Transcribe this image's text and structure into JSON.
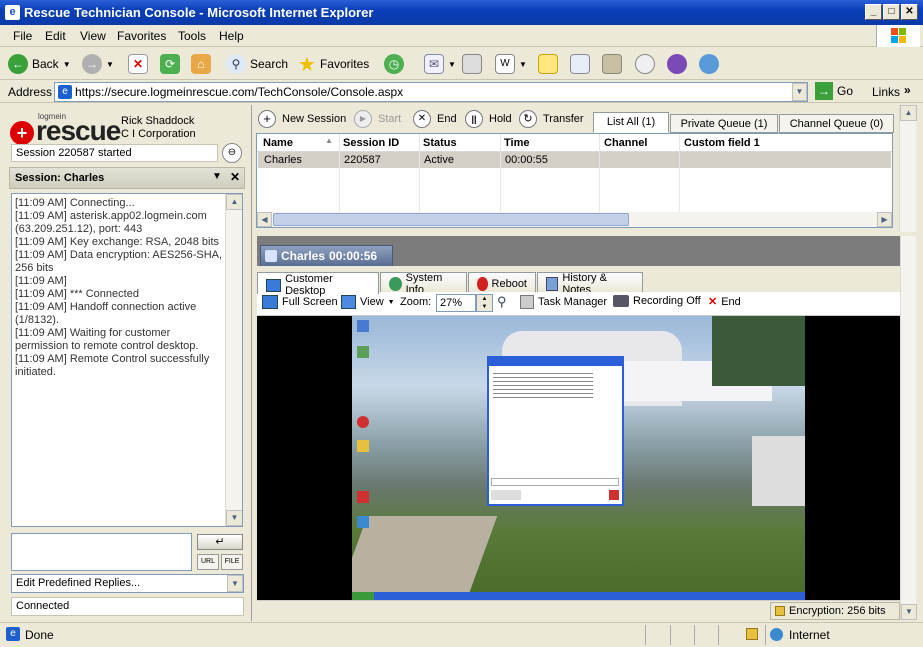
{
  "window": {
    "title": "Rescue Technician Console - Microsoft Internet Explorer"
  },
  "menu": [
    "File",
    "Edit",
    "View",
    "Favorites",
    "Tools",
    "Help"
  ],
  "toolbar": {
    "back": "Back",
    "search": "Search",
    "favorites": "Favorites"
  },
  "address": {
    "label": "Address",
    "url": "https://secure.logmeinrescue.com/TechConsole/Console.aspx",
    "go": "Go",
    "links": "Links"
  },
  "brand": {
    "logo_small": "logmein",
    "logo": "rescue",
    "user": "Rick Shaddock",
    "company": "C I Corporation"
  },
  "session": {
    "started": "Session 220587 started",
    "header": "Session: Charles"
  },
  "log": [
    "[11:09 AM] Connecting...",
    "[11:09 AM] asterisk.app02.logmein.com (63.209.251.12), port: 443",
    "[11:09 AM] Key exchange: RSA, 2048 bits",
    "[11:09 AM] Data encryption: AES256-SHA, 256 bits",
    "[11:09 AM]",
    "[11:09 AM] *** Connected",
    "[11:09 AM] Handoff connection active (1/8132).",
    "[11:09 AM] Waiting for customer permission to remote control desktop.",
    "[11:09 AM] Remote Control successfully initiated."
  ],
  "chat": {
    "url_btn": "URL",
    "file_btn": "FILE",
    "predefined": "Edit Predefined Replies...",
    "status": "Connected"
  },
  "session_toolbar": {
    "new": "New Session",
    "start": "Start",
    "end": "End",
    "hold": "Hold",
    "transfer": "Transfer"
  },
  "queue_tabs": [
    "List All (1)",
    "Private Queue (1)",
    "Channel Queue (0)"
  ],
  "table": {
    "headers": [
      "Name",
      "Session ID",
      "Status",
      "Time",
      "Channel",
      "Custom field 1"
    ],
    "rows": [
      [
        "Charles",
        "220587",
        "Active",
        "00:00:55",
        "",
        ""
      ]
    ]
  },
  "active_session": {
    "label": "Charles",
    "timer": "00:00:56"
  },
  "session_tabs": [
    "Customer Desktop",
    "System Info",
    "Reboot",
    "History & Notes"
  ],
  "desktop_toolbar": {
    "fullscreen": "Full Screen",
    "view": "View",
    "zoom_label": "Zoom:",
    "zoom": "27%",
    "task_manager": "Task Manager",
    "recording": "Recording Off",
    "end": "End"
  },
  "encryption": "Encryption: 256 bits",
  "status": {
    "done": "Done",
    "zone": "Internet"
  }
}
